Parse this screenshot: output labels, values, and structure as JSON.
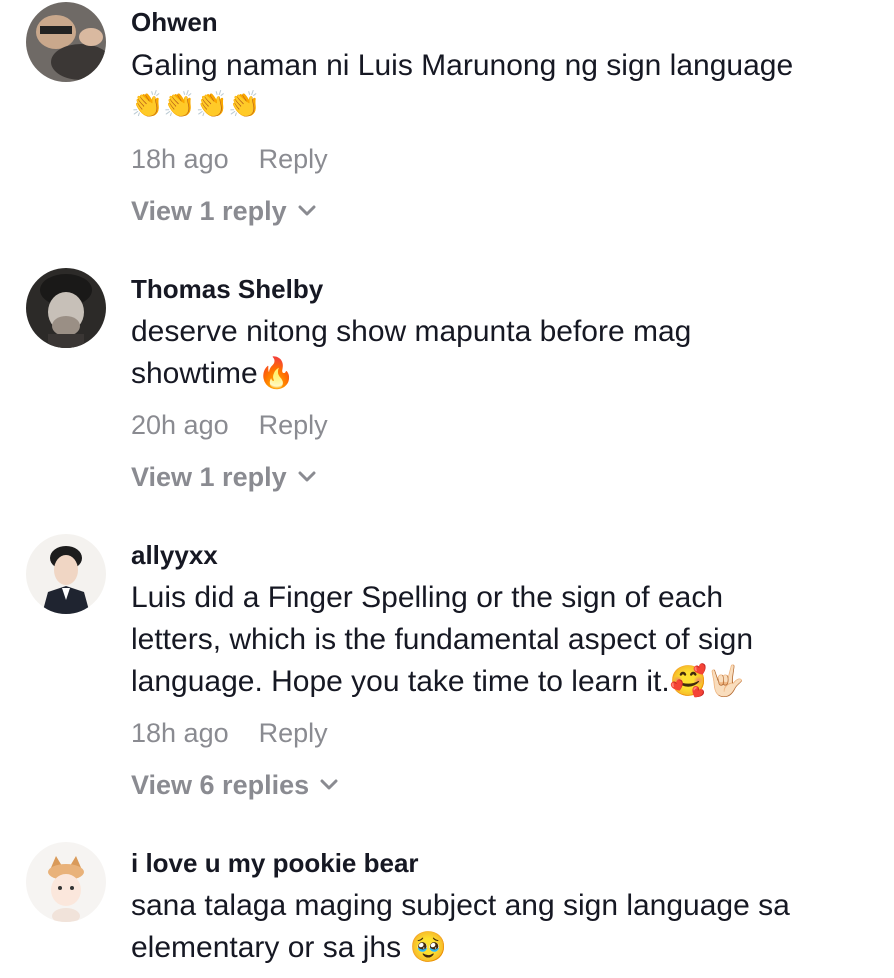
{
  "comments": [
    {
      "username": "Ohwen",
      "text_lines": [
        "Galing naman ni Luis Marunong ng sign language"
      ],
      "emoji_line": "👏👏👏👏",
      "time": "18h ago",
      "reply_label": "Reply",
      "view_replies": "View 1 reply"
    },
    {
      "username": "Thomas Shelby",
      "text_lines": [
        "deserve nitong show mapunta before mag",
        "showtime🔥"
      ],
      "time": "20h ago",
      "reply_label": "Reply",
      "view_replies": "View 1 reply"
    },
    {
      "username": "allyyxx",
      "text_lines": [
        "Luis did a Finger Spelling or the sign of each",
        "letters, which is the fundamental aspect of sign",
        "language. Hope you take time to learn it.🥰🤟🏻"
      ],
      "time": "18h ago",
      "reply_label": "Reply",
      "view_replies": "View 6 replies"
    },
    {
      "username": "i love u my pookie bear",
      "text_lines": [
        "sana talaga maging subject ang sign language sa",
        "elementary or sa jhs 🥹"
      ]
    }
  ],
  "icons": {
    "chevron": "chevron-down-icon",
    "avatar": "avatar"
  }
}
